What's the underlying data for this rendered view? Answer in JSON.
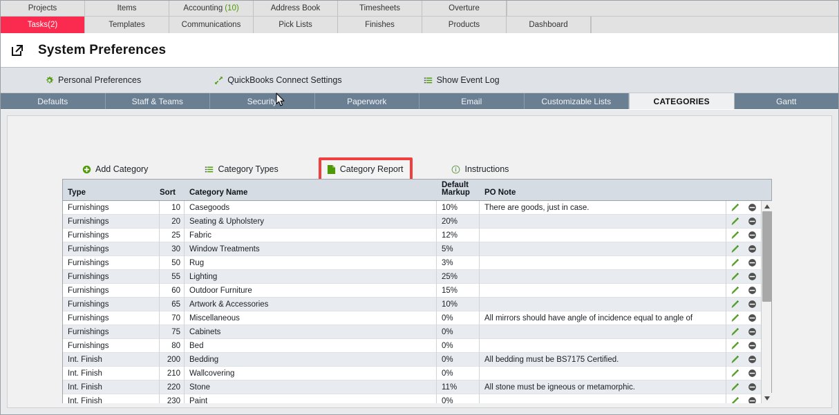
{
  "top_nav": {
    "row1": [
      {
        "label": "Projects",
        "count": null,
        "active": false
      },
      {
        "label": "Items",
        "count": null,
        "active": false
      },
      {
        "label": "Accounting",
        "count": "(10)",
        "active": false
      },
      {
        "label": "Address Book",
        "count": null,
        "active": false
      },
      {
        "label": "Timesheets",
        "count": null,
        "active": false
      },
      {
        "label": "Overture",
        "count": null,
        "active": false
      }
    ],
    "row2": [
      {
        "label": "Tasks",
        "count": "(2)",
        "active": true
      },
      {
        "label": "Templates",
        "count": null,
        "active": false
      },
      {
        "label": "Communications",
        "count": null,
        "active": false
      },
      {
        "label": "Pick Lists",
        "count": null,
        "active": false
      },
      {
        "label": "Finishes",
        "count": null,
        "active": false
      },
      {
        "label": "Products",
        "count": null,
        "active": false
      },
      {
        "label": "Dashboard",
        "count": null,
        "active": false
      }
    ],
    "active_tab_color": "#fb2a4f",
    "count_color": "#4e9a06"
  },
  "header": {
    "title": "System Preferences",
    "external_link_icon": "external-link-icon"
  },
  "utility_links": [
    {
      "label": "Personal Preferences",
      "icon": "gear-icon"
    },
    {
      "label": "QuickBooks Connect Settings",
      "icon": "diagonal-arrows-icon"
    },
    {
      "label": "Show Event Log",
      "icon": "list-icon"
    }
  ],
  "section_tabs": [
    {
      "label": "Defaults",
      "active": false
    },
    {
      "label": "Staff & Teams",
      "active": false
    },
    {
      "label": "Security",
      "active": false
    },
    {
      "label": "Paperwork",
      "active": false
    },
    {
      "label": "Email",
      "active": false
    },
    {
      "label": "Customizable Lists",
      "active": false
    },
    {
      "label": "CATEGORIES",
      "active": true
    },
    {
      "label": "Gantt",
      "active": false
    }
  ],
  "action_links": [
    {
      "label": "Add Category",
      "icon": "plus-circle-icon",
      "highlighted": false
    },
    {
      "label": "Category Types",
      "icon": "list-icon",
      "highlighted": false
    },
    {
      "label": "Category Report",
      "icon": "document-icon",
      "highlighted": true
    },
    {
      "label": "Instructions",
      "icon": "info-circle-icon",
      "highlighted": false
    }
  ],
  "highlight_color": "#ef3f3f",
  "table": {
    "columns": [
      "Type",
      "Sort",
      "Category Name",
      "Default\nMarkup",
      "PO Note"
    ],
    "row_icons": {
      "edit": "pencil-icon",
      "delete": "minus-circle-icon"
    },
    "rows": [
      {
        "type": "Furnishings",
        "sort": "10",
        "name": "Casegoods",
        "markup": "10%",
        "note": "There are goods, just in case."
      },
      {
        "type": "Furnishings",
        "sort": "20",
        "name": "Seating & Upholstery",
        "markup": "20%",
        "note": ""
      },
      {
        "type": "Furnishings",
        "sort": "25",
        "name": "Fabric",
        "markup": "12%",
        "note": ""
      },
      {
        "type": "Furnishings",
        "sort": "30",
        "name": "Window Treatments",
        "markup": "5%",
        "note": ""
      },
      {
        "type": "Furnishings",
        "sort": "50",
        "name": "Rug",
        "markup": "3%",
        "note": ""
      },
      {
        "type": "Furnishings",
        "sort": "55",
        "name": "Lighting",
        "markup": "25%",
        "note": ""
      },
      {
        "type": "Furnishings",
        "sort": "60",
        "name": "Outdoor Furniture",
        "markup": "15%",
        "note": ""
      },
      {
        "type": "Furnishings",
        "sort": "65",
        "name": "Artwork & Accessories",
        "markup": "10%",
        "note": ""
      },
      {
        "type": "Furnishings",
        "sort": "70",
        "name": "Miscellaneous",
        "markup": "0%",
        "note": "All mirrors should have angle of incidence equal to angle of"
      },
      {
        "type": "Furnishings",
        "sort": "75",
        "name": "Cabinets",
        "markup": "0%",
        "note": ""
      },
      {
        "type": "Furnishings",
        "sort": "80",
        "name": "Bed",
        "markup": "0%",
        "note": ""
      },
      {
        "type": "Int. Finish",
        "sort": "200",
        "name": "Bedding",
        "markup": "0%",
        "note": "All bedding must be BS7175 Certified."
      },
      {
        "type": "Int. Finish",
        "sort": "210",
        "name": "Wallcovering",
        "markup": "0%",
        "note": ""
      },
      {
        "type": "Int. Finish",
        "sort": "220",
        "name": "Stone",
        "markup": "11%",
        "note": "All stone must be igneous or metamorphic."
      },
      {
        "type": "Int. Finish",
        "sort": "230",
        "name": "Paint",
        "markup": "0%",
        "note": ""
      }
    ]
  },
  "scrollbar": {
    "up_arrow": "▲",
    "down_arrow": "▼"
  }
}
